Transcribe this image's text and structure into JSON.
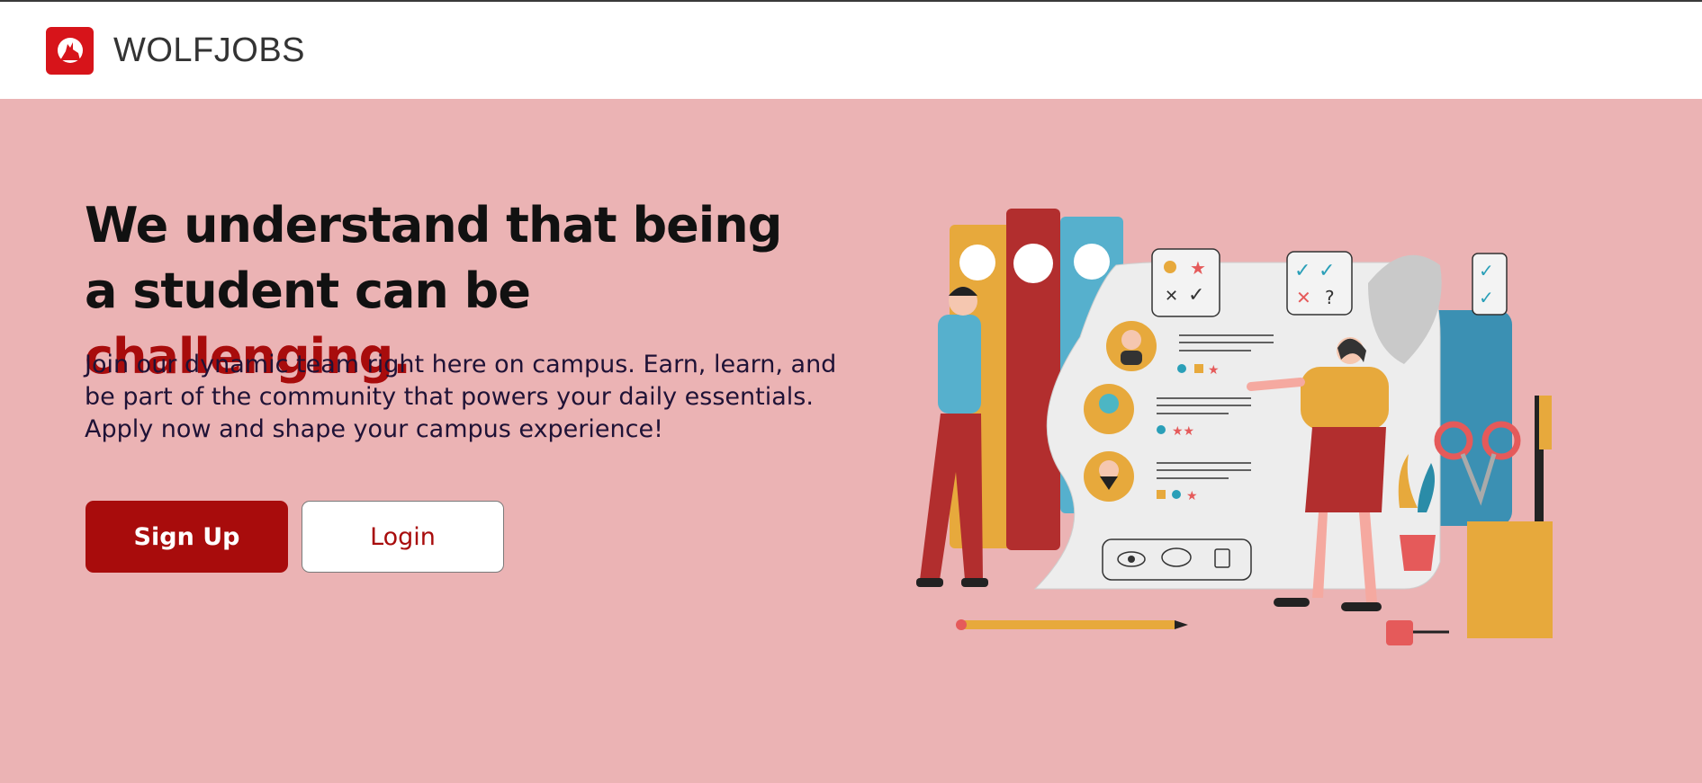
{
  "header": {
    "brand": "WOLFJOBS",
    "logo_icon": "wolf-logo-icon"
  },
  "hero": {
    "title_part1": "We understand that being a student can be ",
    "title_accent": "challenging.",
    "description": "Join our dynamic team right here on campus. Earn, learn, and be part of the community that powers your daily essentials. Apply now and shape your campus experience!",
    "signup_label": "Sign Up",
    "login_label": "Login"
  },
  "colors": {
    "background": "#EBB3B4",
    "accent": "#A80C0C",
    "logo": "#D7141A",
    "header_bg": "#FFFFFF"
  },
  "illustration": {
    "icon": "recruiting-team-illustration"
  }
}
